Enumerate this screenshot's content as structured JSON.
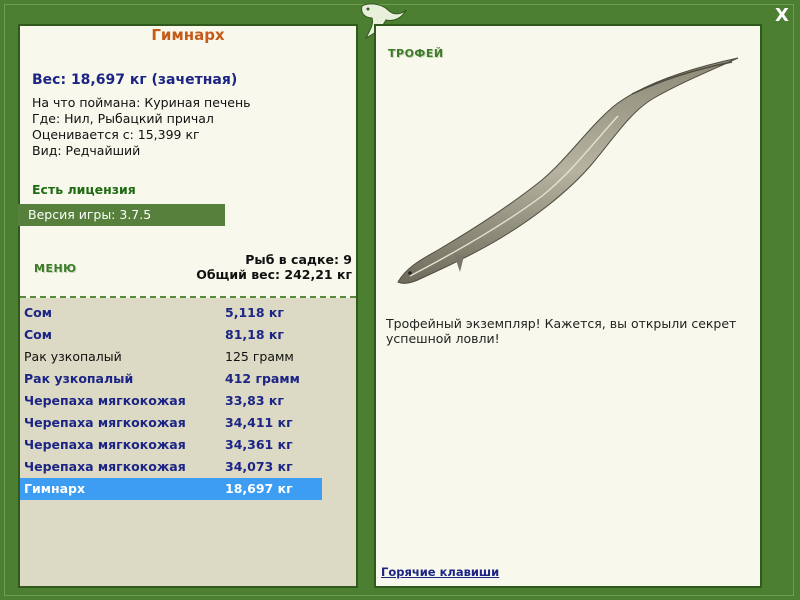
{
  "fish": {
    "name": "Гимнарх",
    "weight_line": "Вес: 18,697 кг (зачетная)",
    "caught_on": "На что поймана: Куриная печень",
    "location": "Где: Нил, Рыбацкий причал",
    "valued_from": "Оценивается с: 15,399 кг",
    "rarity": "Вид: Редчайший"
  },
  "license": "Есть лицензия",
  "version": "Версия игры: 3.7.5",
  "menu_label": "МЕНЮ",
  "cage": {
    "count_line": "Рыб в садке: 9",
    "total_line": "Общий вес: 242,21 кг"
  },
  "catch_list": [
    {
      "name": "Сом",
      "weight": "5,118 кг",
      "style": "bold"
    },
    {
      "name": "Сом",
      "weight": "81,18 кг",
      "style": "bold"
    },
    {
      "name": "Рак узкопалый",
      "weight": "125 грамм",
      "style": "plain"
    },
    {
      "name": "Рак узкопалый",
      "weight": "412 грамм",
      "style": "bold"
    },
    {
      "name": "Черепаха мягкокожая",
      "weight": "33,83 кг",
      "style": "bold"
    },
    {
      "name": "Черепаха мягкокожая",
      "weight": "34,411 кг",
      "style": "bold"
    },
    {
      "name": "Черепаха мягкокожая",
      "weight": "34,361 кг",
      "style": "bold"
    },
    {
      "name": "Черепаха мягкокожая",
      "weight": "34,073 кг",
      "style": "bold"
    },
    {
      "name": "Гимнарх",
      "weight": "18,697 кг",
      "style": "selected"
    }
  ],
  "trophy": {
    "label": "ТРОФЕЙ",
    "text": "Трофейный экземпляр! Кажется, вы открыли секрет успешной ловли!"
  },
  "hotkeys": "Горячие клавиши",
  "close": "X",
  "colors": {
    "frame": "#4d7f33",
    "selected_row": "#3c9df2",
    "list_text": "#1c2585",
    "title": "#c65a18"
  },
  "icons": [
    "lizard-logo-icon",
    "close-icon",
    "fish-trophy-image"
  ]
}
